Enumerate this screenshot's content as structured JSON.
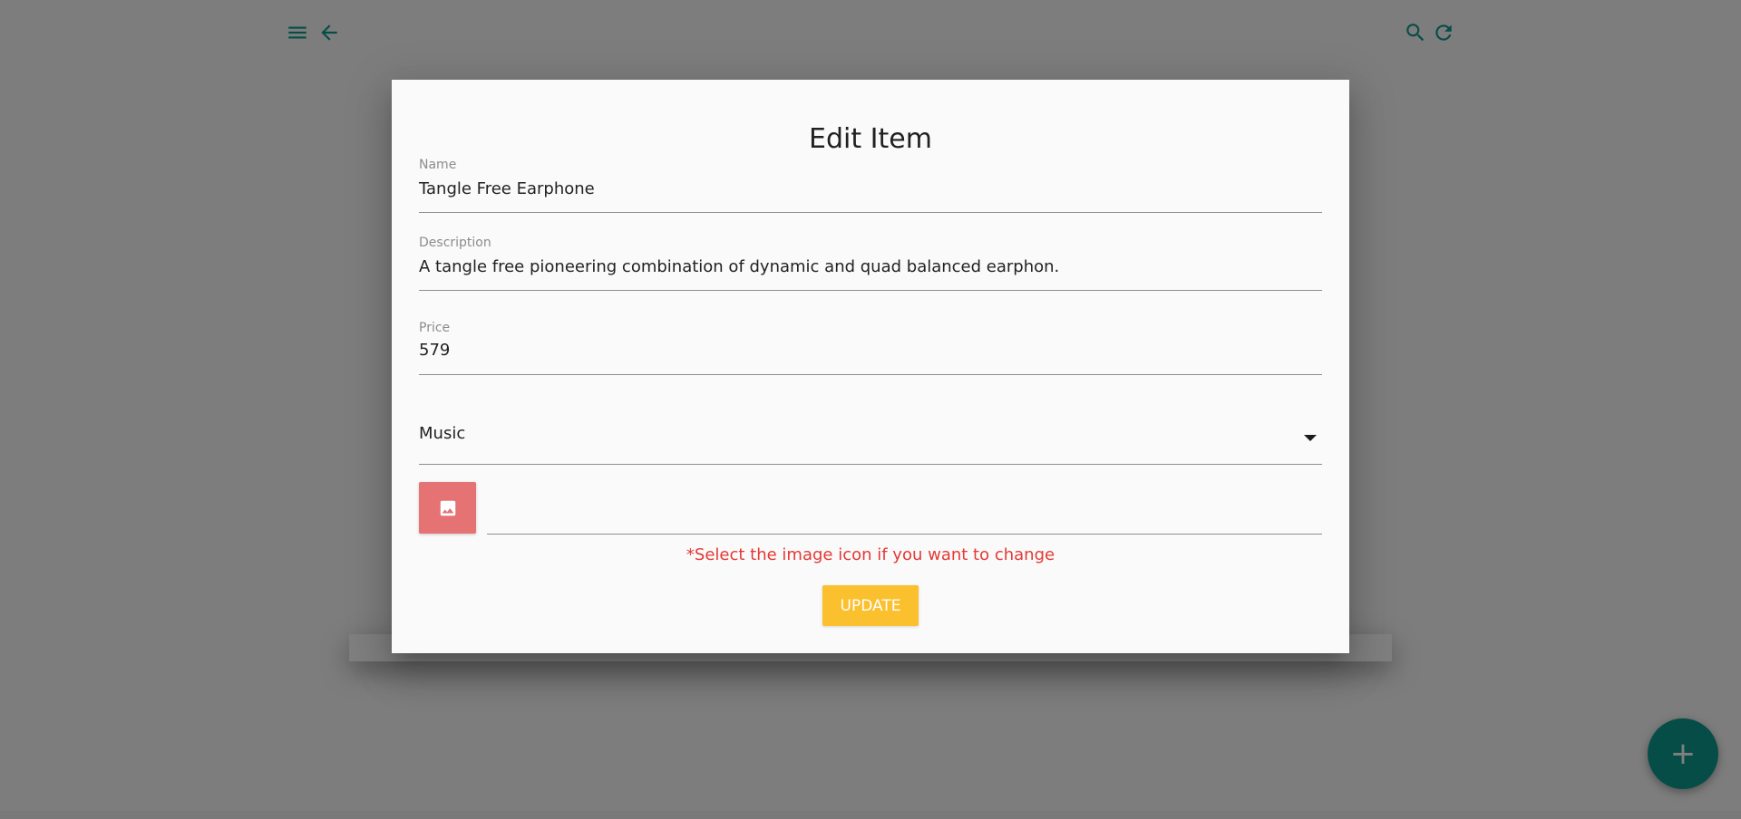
{
  "toolbar": {
    "left_icons": [
      "menu-icon",
      "arrow-back-icon"
    ],
    "right_icons": [
      "search-icon",
      "refresh-icon"
    ],
    "icon_color": "#0f9b8e"
  },
  "fab": {
    "label": "+",
    "color": "#0f9b8e"
  },
  "dialog": {
    "title": "Edit Item",
    "fields": {
      "name": {
        "label": "Name",
        "value": "Tangle Free Earphone"
      },
      "description": {
        "label": "Description",
        "value": "A tangle free pioneering combination of dynamic and quad balanced earphon."
      },
      "price": {
        "label": "Price",
        "value": "579"
      },
      "category": {
        "value": "Music"
      }
    },
    "image_button": {
      "icon": "image-icon",
      "color": "#e57373"
    },
    "hint": "*Select the image icon if you want to change",
    "hint_color": "#e53935",
    "update_label": "UPDATE",
    "update_color": "#fbc02d"
  }
}
